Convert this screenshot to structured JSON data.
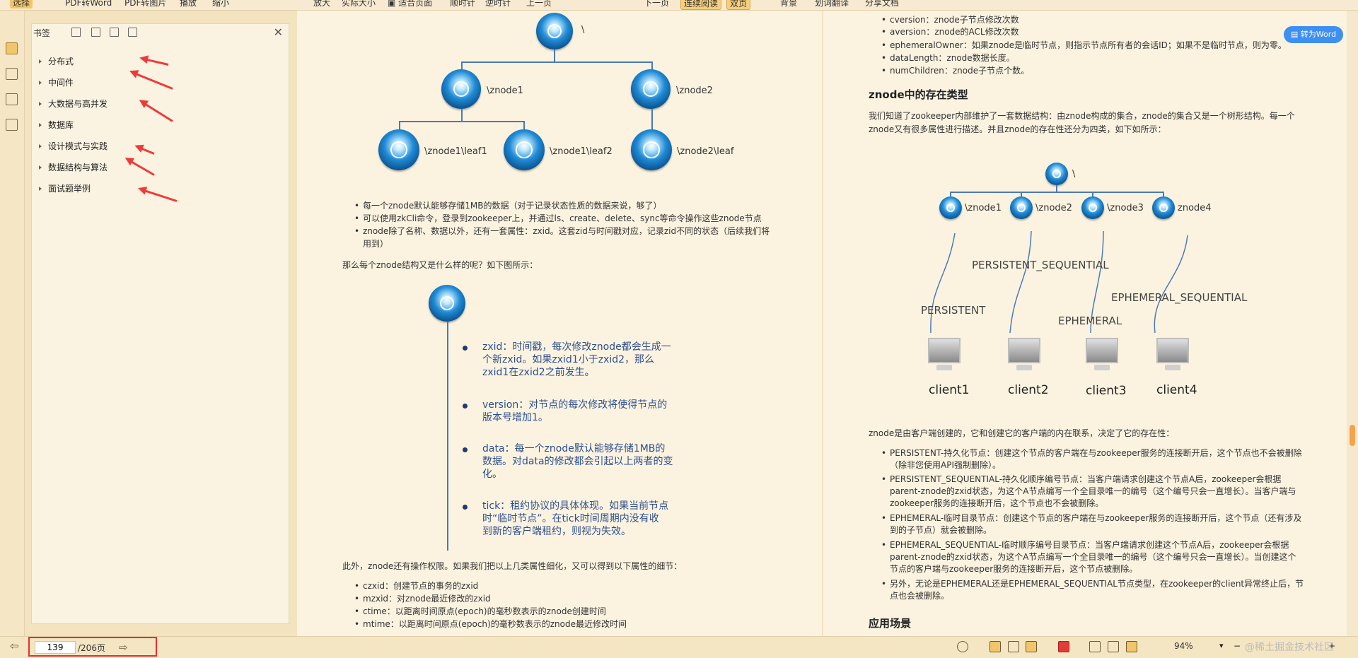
{
  "toolbar": {
    "select": "选择",
    "pdf_to_word": "PDF转Word",
    "pdf_to_image": "PDF转图片",
    "play": "播放",
    "zoom_out": "缩小",
    "zoom_in": "放大",
    "actual_size": "实际大小",
    "fit_page": "适合页面",
    "clockwise": "顺时针",
    "counter_clockwise": "逆时针",
    "prev_page": "上一页",
    "next_page": "下一页",
    "continuous_read": "连续阅读",
    "double_page": "双页",
    "background": "背景",
    "translate": "划词翻译",
    "share": "分享文档"
  },
  "bookmark": {
    "title": "书签",
    "items": [
      "分布式",
      "中间件",
      "大数据与高并发",
      "数据库",
      "设计模式与实践",
      "数据结构与算法",
      "面试题举例"
    ]
  },
  "left_page": {
    "tree": {
      "root": "\\",
      "znode1": "\\znode1",
      "znode2": "\\znode2",
      "leaf1": "\\znode1\\leaf1",
      "leaf2": "\\znode1\\leaf2",
      "leaf3": "\\znode2\\leaf"
    },
    "bullets1": [
      "每一个znode默认能够存储1MB的数据（对于记录状态性质的数据来说，够了）",
      "可以使用zkCli命令，登录到zookeeper上，并通过ls、create、delete、sync等命令操作这些znode节点",
      "znode除了名称、数据以外，还有一套属性：zxid。这套zid与时间戳对应，记录zid不同的状态（后续我们将",
      "用到）"
    ],
    "question": "那么每个znode结构又是什么样的呢？如下图所示：",
    "props": [
      [
        "zxid：时间戳，每次修改znode都会生成一",
        "个新zxid。如果zxid1小于zxid2，那么",
        "zxid1在zxid2之前发生。"
      ],
      [
        "version：对节点的每次修改将使得节点的",
        "版本号增加1。"
      ],
      [
        "data：每一个znode默认能够存储1MB的",
        "数据。对data的修改都会引起以上两者的变",
        "化。"
      ],
      [
        "tick：租约协议的具体体现。如果当前节点",
        "时“临时节点”。在tick时间周期内没有收",
        "到新的客户端租约，则视为失效。"
      ]
    ],
    "also": "此外，znode还有操作权限。如果我们把以上几类属性细化，又可以得到以下属性的细节：",
    "bullets2": [
      "czxid：创建节点的事务的zxid",
      "mzxid：对znode最近修改的zxid",
      "ctime：以距离时间原点(epoch)的毫秒数表示的znode创建时间",
      "mtime：以距离时间原点(epoch)的毫秒数表示的znode最近修改时间"
    ]
  },
  "right_page": {
    "bullets_top": [
      "cversion：znode子节点修改次数",
      "aversion：znode的ACL修改次数",
      "ephemeralOwner：如果znode是临时节点，则指示节点所有者的会话ID；如果不是临时节点，则为零。",
      "dataLength：znode数据长度。",
      "numChildren：znode子节点个数。"
    ],
    "heading1": "znode中的存在类型",
    "para1a": "我们知道了zookeeper内部维护了一套数据结构：由znode构成的集合，znode的集合又是一个树形结构。每一个",
    "para1b": "znode又有很多属性进行描述。并且znode的存在性还分为四类，如下如所示：",
    "diagram": {
      "root": "\\",
      "nodes": [
        "\\znode1",
        "\\znode2",
        "\\znode3",
        "znode4"
      ],
      "types": [
        "PERSISTENT",
        "PERSISTENT_SEQUENTIAL",
        "EPHEMERAL",
        "EPHEMERAL_SEQUENTIAL"
      ],
      "clients": [
        "client1",
        "client2",
        "client3",
        "client4"
      ]
    },
    "para2": "znode是由客户端创建的，它和创建它的客户端的内在联系，决定了它的存在性：",
    "bullets_bottom": [
      [
        "PERSISTENT-持久化节点：创建这个节点的客户端在与zookeeper服务的连接断开后，这个节点也不会被删除",
        "（除非您使用API强制删除）。"
      ],
      [
        "PERSISTENT_SEQUENTIAL-持久化顺序编号节点：当客户端请求创建这个节点A后，zookeeper会根据",
        "parent-znode的zxid状态，为这个A节点编写一个全目录唯一的编号（这个编号只会一直增长）。当客户端与",
        "zookeeper服务的连接断开后，这个节点也不会被删除。"
      ],
      [
        "EPHEMERAL-临时目录节点：创建这个节点的客户端在与zookeeper服务的连接断开后，这个节点（还有涉及",
        "到的子节点）就会被删除。"
      ],
      [
        "EPHEMERAL_SEQUENTIAL-临时顺序编号目录节点：当客户端请求创建这个节点A后，zookeeper会根据",
        "parent-znode的zxid状态，为这个A节点编写一个全目录唯一的编号（这个编号只会一直增长）。当创建这个",
        "节点的客户端与zookeeper服务的连接断开后，这个节点被删除。"
      ],
      [
        "另外，无论是EPHEMERAL还是EPHEMERAL_SEQUENTIAL节点类型，在zookeeper的client异常终止后，节",
        "点也会被删除。"
      ]
    ],
    "heading2": "应用场景"
  },
  "to_word_button": "转为Word",
  "status": {
    "current_page": "139",
    "total": "/206页",
    "zoom": "94%",
    "watermark": "@稀土掘金技术社区"
  },
  "colors": {
    "accent": "#f3c56a",
    "highlight_red": "#ef2b2b",
    "node_blue": "#1f8bd6",
    "word_blue": "#3d8ff2"
  }
}
